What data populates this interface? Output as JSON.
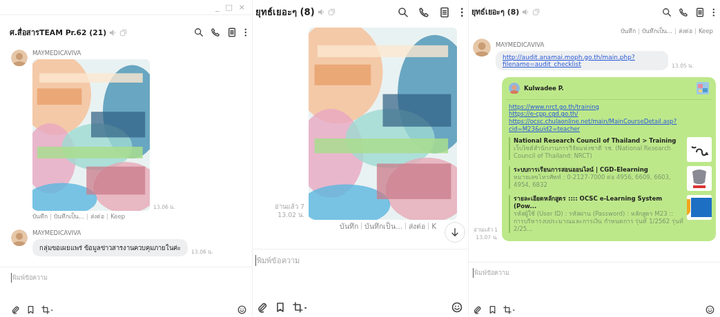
{
  "panes": [
    {
      "window_controls": [
        "_",
        "□",
        "×"
      ],
      "title": "ศ.สื่อสารTEAM Pr.62 (21)",
      "messages": [
        {
          "outgoing": false,
          "sender": "MAYMEDICAVIVA",
          "time": "13.06 น.",
          "actions": [
            "บันทึก",
            "บันทึกเป็น...",
            "ส่งต่อ",
            "Keep"
          ]
        },
        {
          "kind": "text",
          "outgoing": false,
          "sender": "MAYMEDICAVIVA",
          "text": "กลุ่มขอเผยแพร่ ข้อมูลข่าวสารงานควบคุมภายในค่ะ",
          "time": "13.06 น."
        }
      ],
      "show_scroll_button": false,
      "input": {
        "placeholder": "พิมพ์ข้อความ"
      }
    },
    {
      "title": "ยุทธ์เยอะๆ (8)",
      "messages": [
        {
          "outgoing": true,
          "read": "อ่านแล้ว 7",
          "time": "13.02 น.",
          "actions": [
            "บันทึก",
            "บันทึกเป็น...",
            "ส่งต่อ",
            "K"
          ]
        }
      ],
      "show_scroll_button": true,
      "input": {
        "placeholder": "พิมพ์ข้อความ"
      }
    },
    {
      "title": "ยุทธ์เยอะๆ (8)",
      "messages": [
        {
          "kind": "actions",
          "outgoing": true,
          "actions": [
            "บันทึก",
            "บันทึกเป็น...",
            "ส่งต่อ",
            "Keep"
          ]
        },
        {
          "kind": "link",
          "outgoing": false,
          "sender": "MAYMEDICAVIVA",
          "lines": [
            "http://audit.anamai.moph.go.th/main.php?",
            "filename=audit_checklist"
          ],
          "time": "13.05 น."
        },
        {
          "kind": "share",
          "outgoing": true,
          "from": "Kulwadee P.",
          "links": [
            "https://www.nrct.go.th/training",
            "https://e-cpp.cgd.go.th/",
            "https://ocsc.chulaonline.net/main/MainCourseDetail.asp?",
            "cid=M23&uid2=teacher"
          ],
          "previews": [
            {
              "title": "National Research Council of Thailand > Training",
              "description": "เว็บไซต์สำนักงานการวิจัยแห่งชาติ วช. (National Research Council of Thailand: NRCT)"
            },
            {
              "title": "ระบบการเรียนการสอนออนไลน์ | CGD-Elearning",
              "description": "หมายเลขโทรศัพท์ : 0-2127-7000 ต่อ 4956, 6609, 6603, 4954, 6832"
            },
            {
              "title": "รายละเอียดหลักสูตร :::: OCSC e-Learning System (Pow...",
              "description": "รหัสผู้ใช้ (User ID) : รหัสผ่าน (Password) : หลักสูตร M23 :: การบริหารงบประมาณและการเงิน กำหนดการ รุ่นที่ 1/2562 รุ่นที่ 2/25..."
            }
          ],
          "read": "อ่านแล้ว 1",
          "time": "13.07 น."
        }
      ],
      "show_scroll_button": false,
      "input": {
        "placeholder": "พิมพ์ข้อความ"
      }
    }
  ]
}
